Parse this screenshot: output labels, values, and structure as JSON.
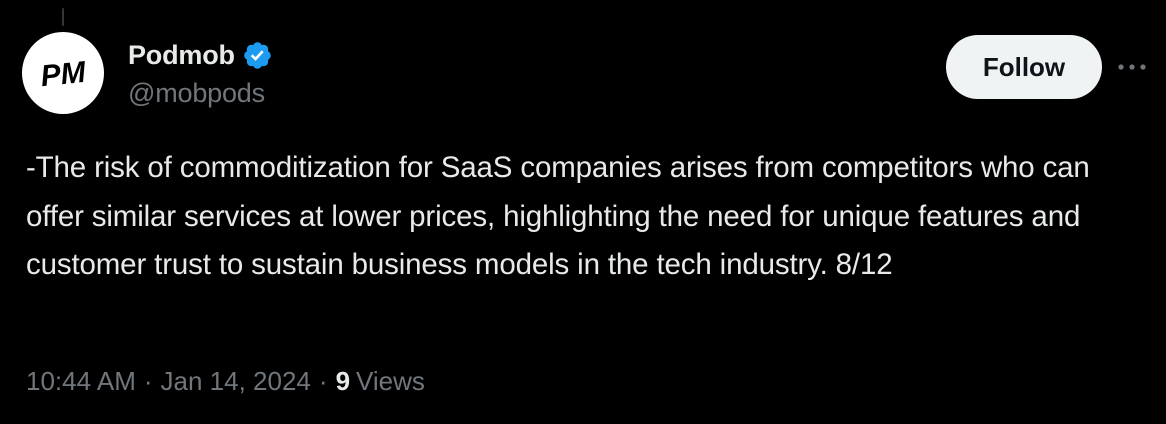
{
  "tweet": {
    "author": {
      "display_name": "Podmob",
      "handle": "@mobpods",
      "avatar_text": "PM",
      "verified": true,
      "verified_color": "#1d9bf0"
    },
    "follow_label": "Follow",
    "more_icon": "more-horizontal-icon",
    "text": "-The risk of commoditization for SaaS companies arises from competitors who can offer similar services at lower prices, highlighting the need for unique features and customer trust to sustain business models in the tech industry. 8/12",
    "time": "10:44 AM",
    "separator": "·",
    "date": "Jan 14, 2024",
    "views_count": "9",
    "views_label": "Views"
  },
  "colors": {
    "background": "#000000",
    "text_primary": "#e7e9ea",
    "text_secondary": "#71767b",
    "follow_bg": "#eff3f4",
    "follow_text": "#0f1419"
  }
}
